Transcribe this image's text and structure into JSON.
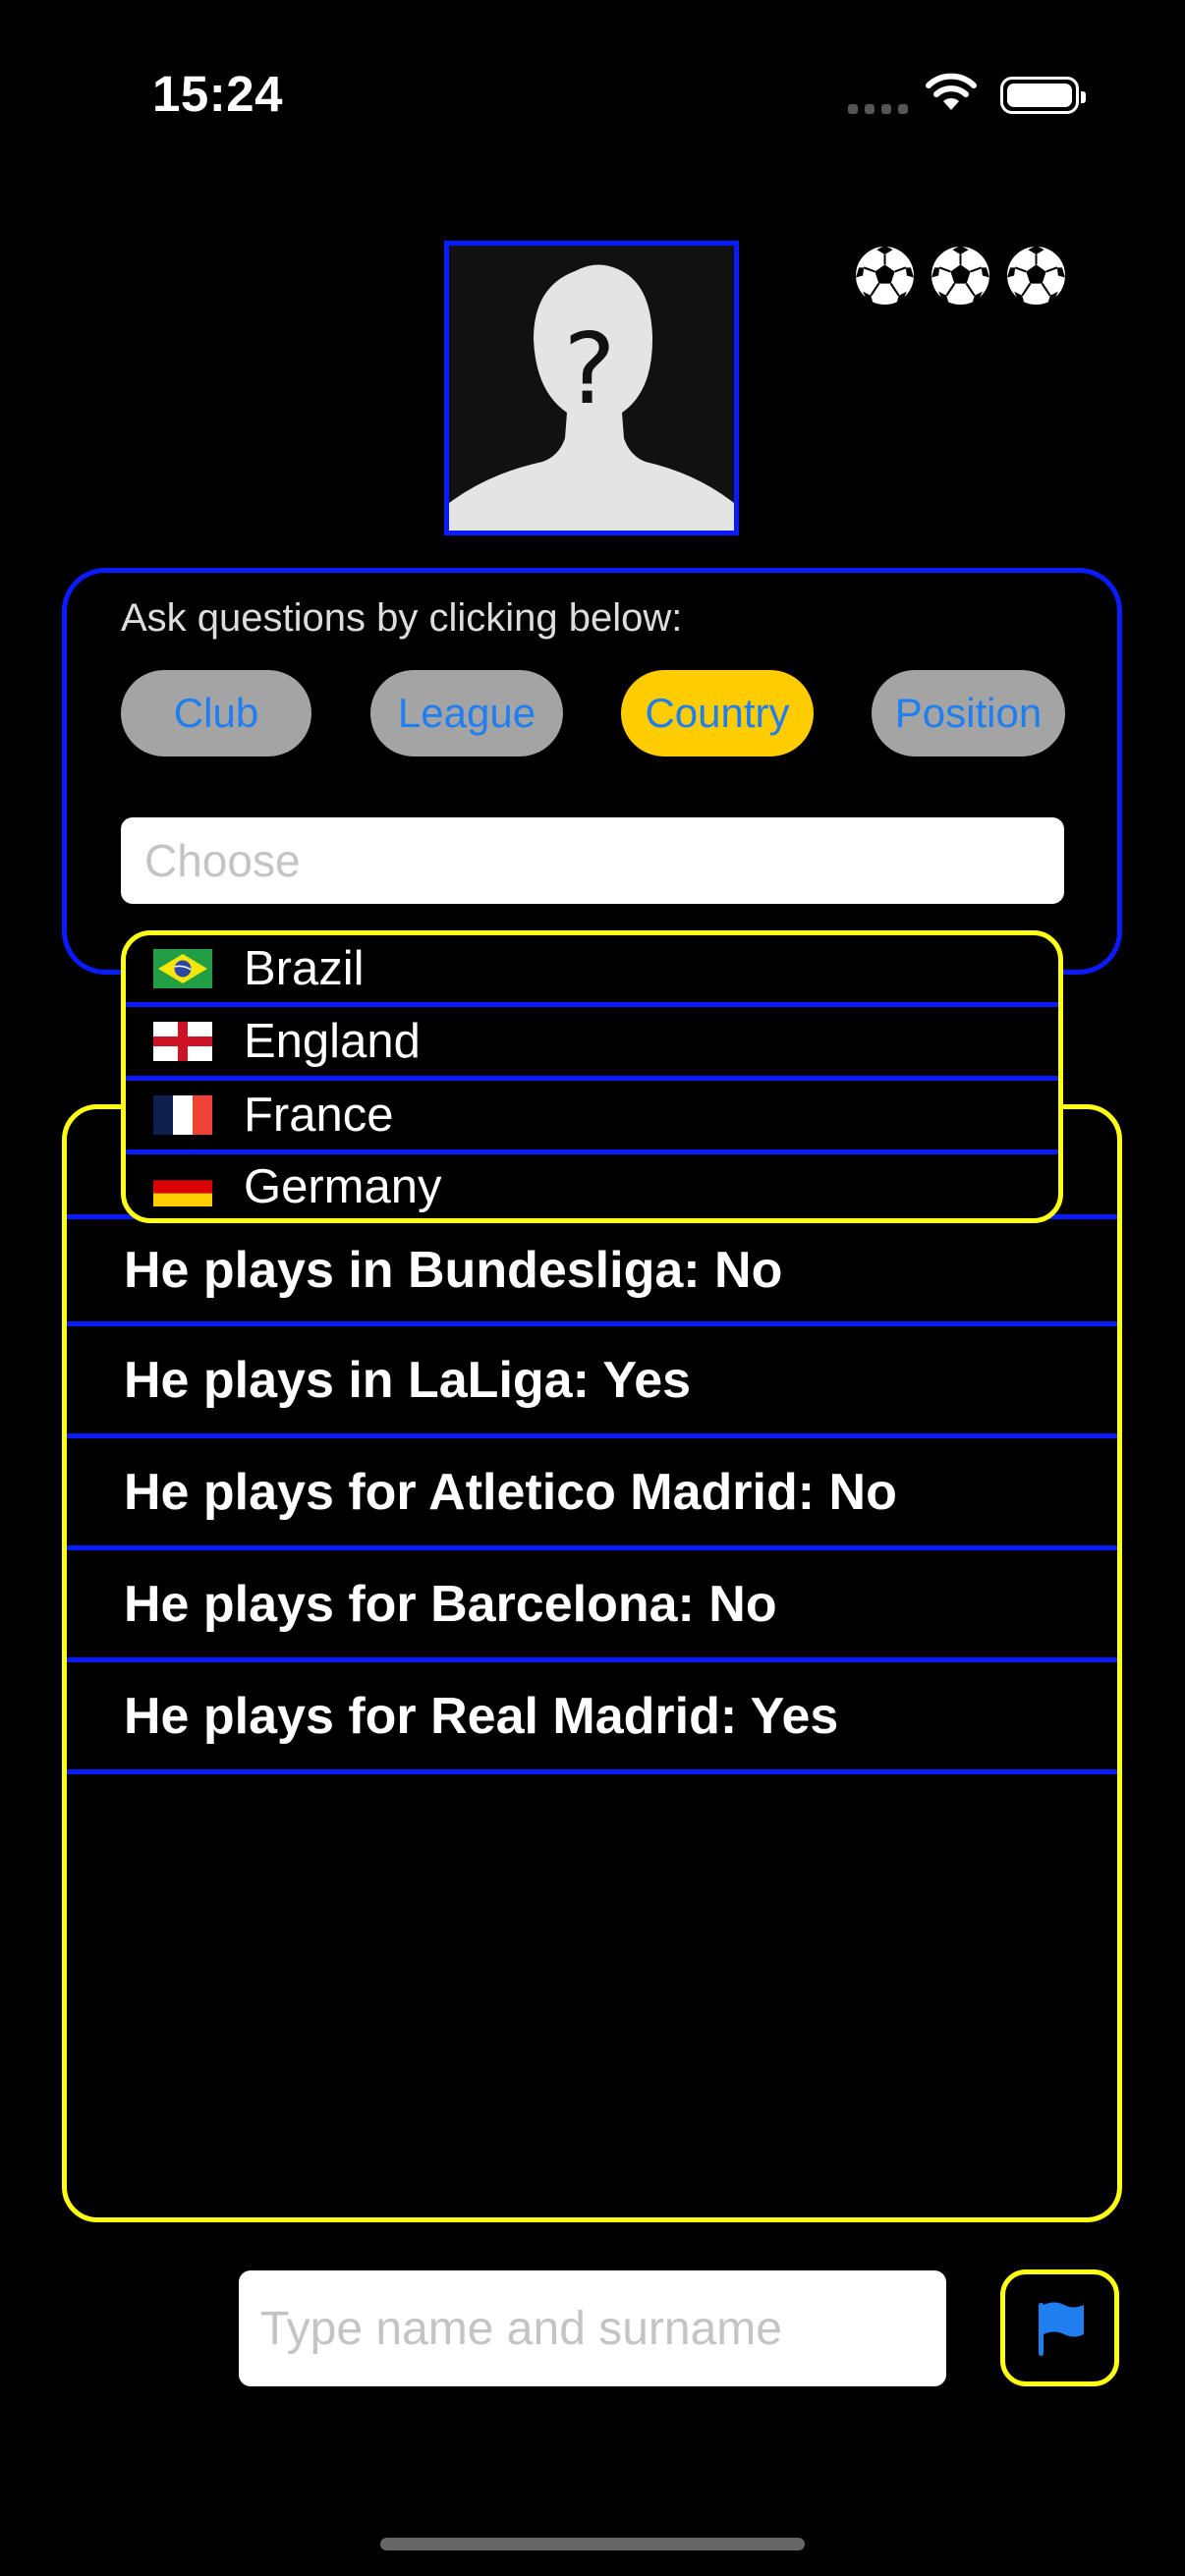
{
  "status_bar": {
    "time": "15:24"
  },
  "lives": {
    "count": 3,
    "icon": "soccer-ball-icon"
  },
  "question_panel": {
    "prompt": "Ask questions by clicking below:",
    "categories": [
      {
        "label": "Club",
        "active": false
      },
      {
        "label": "League",
        "active": false
      },
      {
        "label": "Country",
        "active": true
      },
      {
        "label": "Position",
        "active": false
      }
    ],
    "choose_placeholder": "Choose"
  },
  "dropdown": {
    "options": [
      {
        "label": "Brazil",
        "flag": "brazil-flag-icon"
      },
      {
        "label": "England",
        "flag": "england-flag-icon"
      },
      {
        "label": "France",
        "flag": "france-flag-icon"
      },
      {
        "label": "Germany",
        "flag": "germany-flag-icon"
      }
    ]
  },
  "answers": [
    "He plays in Bundesliga: No",
    "He plays in LaLiga: Yes",
    "He plays for Atletico Madrid: No",
    "He plays for Barcelona: No",
    "He plays for Real Madrid: Yes"
  ],
  "guess": {
    "placeholder": "Type name and surname",
    "button_icon": "flag-icon"
  },
  "colors": {
    "accent_blue": "#0a1cff",
    "accent_yellow": "#ffff14",
    "chip_active": "#ffcc00",
    "chip_text": "#1f7ff0"
  }
}
